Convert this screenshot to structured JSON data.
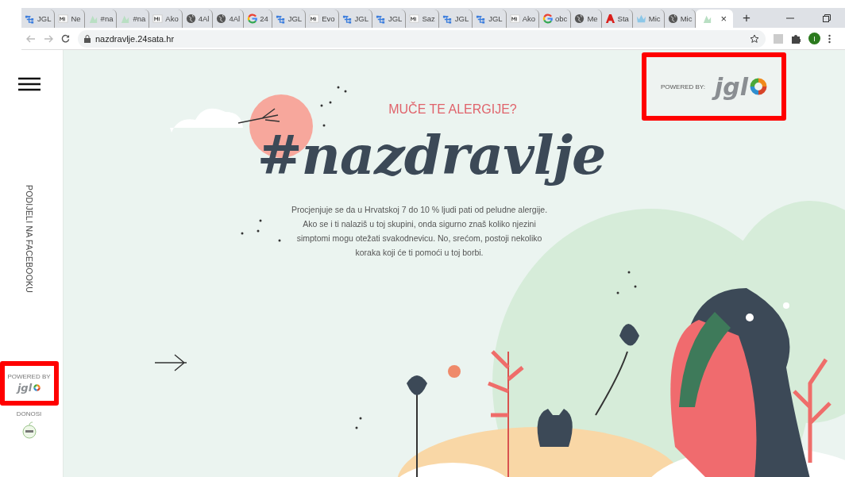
{
  "browser": {
    "tabs": [
      {
        "title": "JGL",
        "kind": "tree",
        "selected": false
      },
      {
        "title": "Ne",
        "kind": "m",
        "selected": false
      },
      {
        "title": "#na",
        "kind": "leaf",
        "selected": false
      },
      {
        "title": "#na",
        "kind": "leaf",
        "selected": false
      },
      {
        "title": "Ako",
        "kind": "m",
        "selected": false
      },
      {
        "title": "4Al",
        "kind": "globe",
        "selected": false
      },
      {
        "title": "4Al",
        "kind": "globe",
        "selected": false
      },
      {
        "title": "24",
        "kind": "google",
        "selected": false
      },
      {
        "title": "JGL",
        "kind": "tree",
        "selected": false
      },
      {
        "title": "Evo",
        "kind": "m",
        "selected": false
      },
      {
        "title": "JGL",
        "kind": "tree",
        "selected": false
      },
      {
        "title": "JGL",
        "kind": "tree",
        "selected": false
      },
      {
        "title": "Saz",
        "kind": "m",
        "selected": false
      },
      {
        "title": "JGL",
        "kind": "tree",
        "selected": false
      },
      {
        "title": "JGL",
        "kind": "tree",
        "selected": false
      },
      {
        "title": "Ako",
        "kind": "m",
        "selected": false
      },
      {
        "title": "obc",
        "kind": "google",
        "selected": false
      },
      {
        "title": "Me",
        "kind": "globe",
        "selected": false
      },
      {
        "title": "Sta",
        "kind": "redlogo",
        "selected": false
      },
      {
        "title": "Mic",
        "kind": "crown",
        "selected": false
      },
      {
        "title": "Mic",
        "kind": "globe",
        "selected": false
      },
      {
        "kind": "leaf",
        "selected": true,
        "close": "×"
      }
    ],
    "new_tab": "+",
    "url": "nazdravlje.24sata.hr",
    "profile": "I"
  },
  "page": {
    "sidebar": {
      "share": "PODIJELI NA FACEBOOKU",
      "powered_by": "POWERED BY",
      "brand": "jgl",
      "presented_by": "DONOSI"
    },
    "header_logo": {
      "powered_by": "POWERED BY:",
      "brand": "jgl"
    },
    "kicker": "MUČE TE ALERGIJE?",
    "title": "#nazdravlje",
    "intro": "Procjenjuje se da u Hrvatskoj 7 do 10 % ljudi pati od peludne alergije. Ako se i ti nalaziš u toj skupini, onda sigurno znaš koliko njezini simptomi mogu otežati svakodnevicu. No, srećom, postoji nekoliko koraka koji će ti pomoći u toj borbi."
  }
}
